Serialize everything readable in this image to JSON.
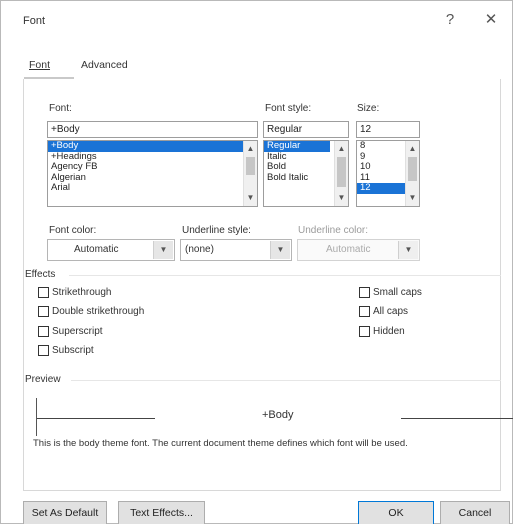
{
  "window": {
    "title": "Font",
    "help_icon": "?",
    "close_icon": "✕"
  },
  "tabs": [
    {
      "label": "Font",
      "active": true
    },
    {
      "label": "Advanced",
      "active": false
    }
  ],
  "font": {
    "label": "Font:",
    "value": "+Body",
    "items": [
      "+Body",
      "+Headings",
      "Agency FB",
      "Algerian",
      "Arial"
    ],
    "selected_index": 0
  },
  "font_style": {
    "label": "Font style:",
    "value": "Regular",
    "items": [
      "Regular",
      "Italic",
      "Bold",
      "Bold Italic"
    ],
    "selected_index": 0
  },
  "size": {
    "label": "Size:",
    "value": "12",
    "items": [
      "8",
      "9",
      "10",
      "11",
      "12"
    ],
    "selected_index": 4
  },
  "font_color": {
    "label": "Font color:",
    "value": "Automatic"
  },
  "underline_style": {
    "label": "Underline style:",
    "value": "(none)"
  },
  "underline_color": {
    "label": "Underline color:",
    "value": "Automatic"
  },
  "effects": {
    "label": "Effects",
    "left": [
      "Strikethrough",
      "Double strikethrough",
      "Superscript",
      "Subscript"
    ],
    "right": [
      "Small caps",
      "All caps",
      "Hidden"
    ]
  },
  "preview": {
    "label": "Preview",
    "sample": "+Body",
    "description": "This is the body theme font. The current document theme defines which font will be used."
  },
  "buttons": {
    "set_default": "Set As Default",
    "text_effects": "Text Effects...",
    "ok": "OK",
    "cancel": "Cancel"
  },
  "icons": {
    "scroll_up": "▲",
    "scroll_down": "▼",
    "dropdown": "▼"
  }
}
